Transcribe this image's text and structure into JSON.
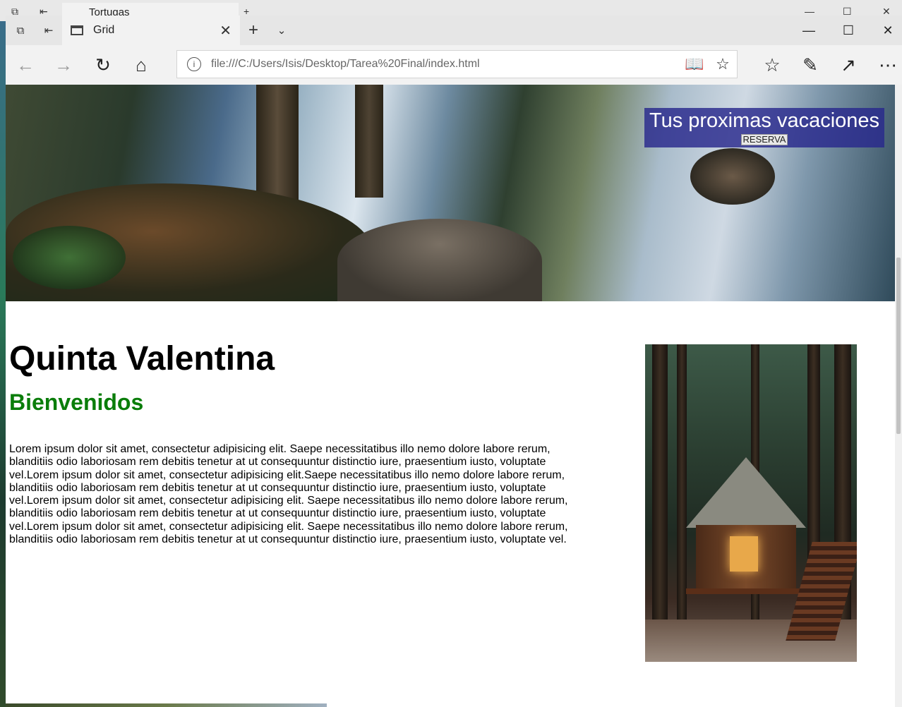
{
  "background_window": {
    "tab_title": "Tortugas"
  },
  "browser": {
    "tab": {
      "title": "Grid"
    },
    "address_url": "file:///C:/Users/Isis/Desktop/Tarea%20Final/index.html"
  },
  "page": {
    "promo": {
      "title": "Tus proximas vacaciones",
      "button": "RESERVA"
    },
    "title": "Quinta Valentina",
    "subtitle": "Bienvenidos",
    "paragraph": "Lorem ipsum dolor sit amet, consectetur adipisicing elit. Saepe necessitatibus illo nemo dolore labore rerum, blanditiis odio laboriosam rem debitis tenetur at ut consequuntur distinctio iure, praesentium iusto, voluptate vel.Lorem ipsum dolor sit amet, consectetur adipisicing elit.Saepe necessitatibus illo nemo dolore labore rerum, blanditiis odio laboriosam rem debitis tenetur at ut consequuntur distinctio iure, praesentium iusto, voluptate vel.Lorem ipsum dolor sit amet, consectetur adipisicing elit. Saepe necessitatibus illo nemo dolore labore rerum, blanditiis odio laboriosam rem debitis tenetur at ut consequuntur distinctio iure, praesentium iusto, voluptate vel.Lorem ipsum dolor sit amet, consectetur adipisicing elit. Saepe necessitatibus illo nemo dolore labore rerum, blanditiis odio laboriosam rem debitis tenetur at ut consequuntur distinctio iure, praesentium iusto, voluptate vel."
  },
  "colors": {
    "subtitle": "#0a7d0a",
    "promo_bg": "#28288c"
  },
  "icons": [
    "tab-actions-icon",
    "set-aside-tabs-icon",
    "tab-page-icon",
    "close-icon",
    "new-tab-icon",
    "tab-list-chevron-icon",
    "minimize-icon",
    "maximize-icon",
    "back-icon",
    "forward-icon",
    "refresh-icon",
    "home-icon",
    "info-icon",
    "reading-view-icon",
    "favorite-star-icon",
    "favorites-hub-icon",
    "web-note-icon",
    "share-icon",
    "more-icon"
  ]
}
